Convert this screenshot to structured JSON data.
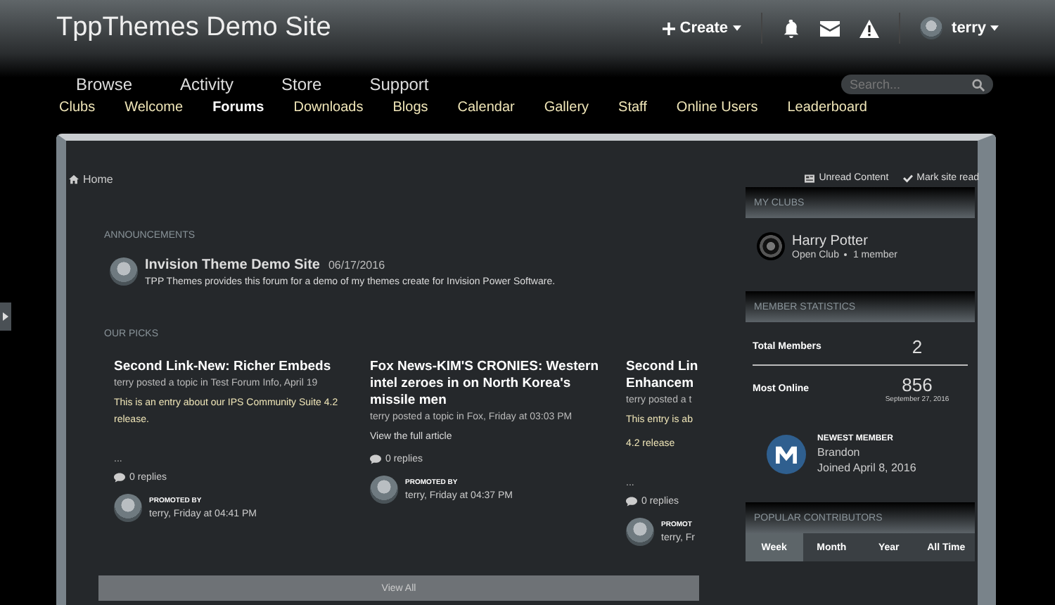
{
  "header": {
    "site_title": "TppThemes Demo Site",
    "create_label": "Create",
    "user_name": "terry"
  },
  "primary_nav": [
    {
      "label": "Browse"
    },
    {
      "label": "Activity"
    },
    {
      "label": "Store"
    },
    {
      "label": "Support"
    }
  ],
  "search": {
    "placeholder": "Search..."
  },
  "secondary_nav": [
    {
      "label": "Clubs",
      "selected": false
    },
    {
      "label": "Welcome",
      "selected": false
    },
    {
      "label": "Forums",
      "selected": true
    },
    {
      "label": "Downloads",
      "selected": false
    },
    {
      "label": "Blogs",
      "selected": false
    },
    {
      "label": "Calendar",
      "selected": false
    },
    {
      "label": "Gallery",
      "selected": false
    },
    {
      "label": "Staff",
      "selected": false
    },
    {
      "label": "Online Users",
      "selected": false
    },
    {
      "label": "Leaderboard",
      "selected": false
    }
  ],
  "breadcrumb": {
    "label": "Home"
  },
  "actions": {
    "unread_label": "Unread Content",
    "mark_read_label": "Mark site read"
  },
  "announcements": {
    "heading": "ANNOUNCEMENTS",
    "items": [
      {
        "title": "Invision Theme Demo Site",
        "date": "06/17/2016",
        "body": "TPP Themes provides this forum for a demo of my themes create for Invision Power Software."
      }
    ]
  },
  "our_picks": {
    "heading": "OUR PICKS",
    "view_all": "View All",
    "cards": [
      {
        "title": [
          "Second Link-New: Richer Embeds"
        ],
        "meta": "terry posted a topic in Test Forum Info, April 19",
        "body": [
          "This is an entry about our IPS Community Suite 4.2 release."
        ],
        "ellipsis": "...",
        "replies": "0 replies",
        "promoted_label": "PROMOTED BY",
        "promoted_meta": "terry, Friday at 04:41 PM"
      },
      {
        "title": [
          "Fox News-KIM'S CRONIES: Western intel zeroes in on North Korea's missile men"
        ],
        "meta": "terry posted a topic in Fox, Friday at 03:03 PM",
        "body": [
          "View the full article"
        ],
        "replies": "0 replies",
        "promoted_label": "PROMOTED BY",
        "promoted_meta": "terry, Friday at 04:37 PM"
      },
      {
        "title": [
          "Second Lin",
          "Enhancem"
        ],
        "meta": "terry posted a t",
        "body": [
          "This entry is ab",
          "4.2 release"
        ],
        "ellipsis": "...",
        "replies": "0 replies",
        "promoted_label": "PROMOT",
        "promoted_meta": "terry, Fr"
      }
    ]
  },
  "my_clubs": {
    "heading": "MY CLUBS",
    "clubs": [
      {
        "name": "Harry Potter",
        "type": "Open Club",
        "members": "1 member"
      }
    ]
  },
  "member_statistics": {
    "heading": "MEMBER STATISTICS",
    "total_label": "Total Members",
    "total_value": "2",
    "most_label": "Most Online",
    "most_value": "856",
    "most_date": "September 27, 2016",
    "newest_label": "NEWEST MEMBER",
    "newest_name": "Brandon",
    "newest_joined": "Joined April 8, 2016"
  },
  "popular_contributors": {
    "heading": "POPULAR CONTRIBUTORS",
    "tabs": [
      {
        "label": "Week",
        "selected": true
      },
      {
        "label": "Month",
        "selected": false
      },
      {
        "label": "Year",
        "selected": false
      },
      {
        "label": "All Time",
        "selected": false
      }
    ]
  }
}
